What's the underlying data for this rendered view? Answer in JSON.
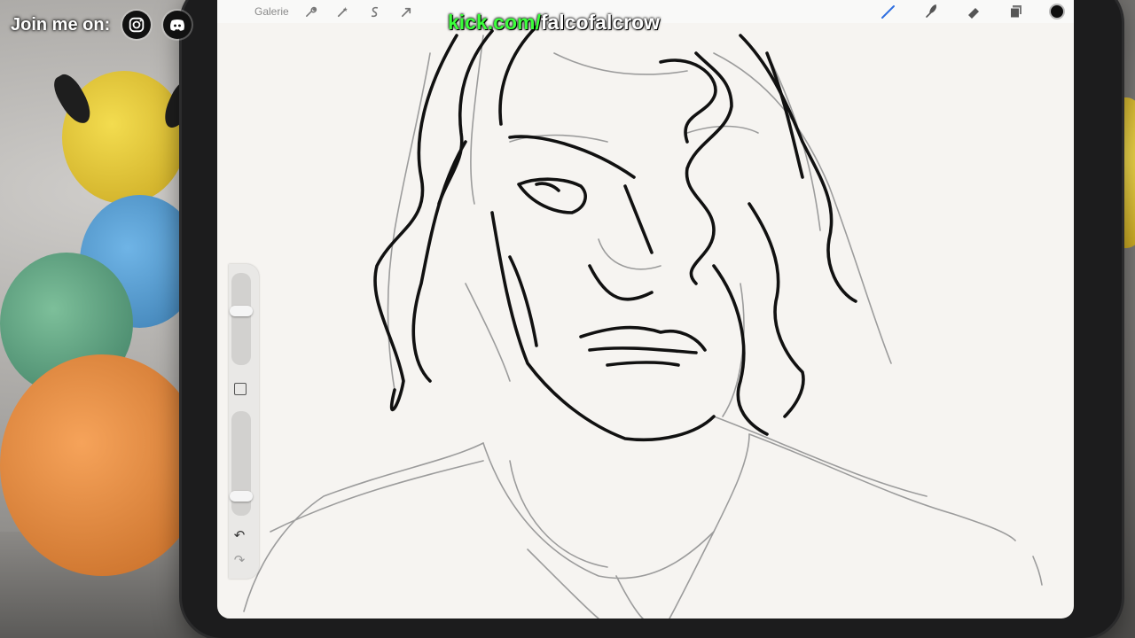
{
  "overlay": {
    "join_label": "Join me on:",
    "socials": [
      {
        "name": "instagram",
        "icon": "instagram-icon"
      },
      {
        "name": "discord",
        "icon": "discord-icon"
      }
    ],
    "stream_url_domain": "kick.com/",
    "stream_url_handle": "falcofalcrow"
  },
  "procreate": {
    "gallery_label": "Galerie",
    "left_tools": [
      "wrench-icon",
      "magic-wand-icon",
      "selection-icon",
      "transform-arrow-icon"
    ],
    "right_tools": [
      "brush-icon",
      "smudge-icon",
      "eraser-icon",
      "layers-icon"
    ],
    "current_color": "#0e0e0e",
    "active_tool_color": "#2f6fe0",
    "sidebar": {
      "brush_size_level": 0.6,
      "opacity_level": 0.15
    }
  },
  "colors": {
    "kick_green": "#3bff3b",
    "canvas_bg": "#f6f4f1"
  }
}
